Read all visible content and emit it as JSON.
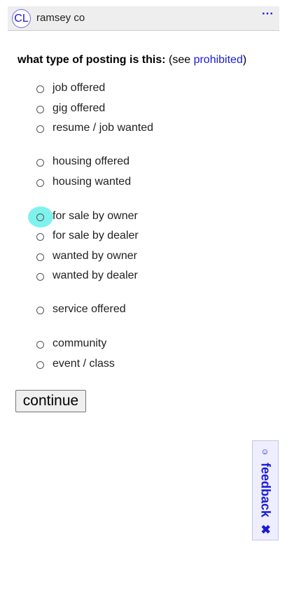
{
  "header": {
    "logo_text": "CL",
    "area_name": "ramsey co",
    "menu_icon": "ellipsis-icon",
    "menu_text": "···"
  },
  "question": {
    "bold_text": "what type of posting is this:",
    "see_text": " (see ",
    "link_text": "prohibited",
    "close_text": ")"
  },
  "options": [
    {
      "label": "job offered",
      "selected": false,
      "focused": false
    },
    {
      "label": "gig offered",
      "selected": false,
      "focused": false
    },
    {
      "label": "resume / job wanted",
      "selected": false,
      "focused": false
    },
    {
      "label": "housing offered",
      "selected": false,
      "focused": false
    },
    {
      "label": "housing wanted",
      "selected": false,
      "focused": false
    },
    {
      "label": "for sale by owner",
      "selected": false,
      "focused": true
    },
    {
      "label": "for sale by dealer",
      "selected": false,
      "focused": false
    },
    {
      "label": "wanted by owner",
      "selected": false,
      "focused": false
    },
    {
      "label": "wanted by dealer",
      "selected": false,
      "focused": false
    },
    {
      "label": "service offered",
      "selected": false,
      "focused": false
    },
    {
      "label": "community",
      "selected": false,
      "focused": false
    },
    {
      "label": "event / class",
      "selected": false,
      "focused": false
    }
  ],
  "continue_button": {
    "label": "continue"
  },
  "feedback": {
    "label": "feedback",
    "smile_icon": "smiley-icon",
    "smile_glyph": "☺",
    "close_icon": "close-icon",
    "close_glyph": "✖"
  },
  "colors": {
    "link": "#1a1ad6",
    "header_bg": "#eeeeee",
    "focus_ring": "#7ff2ee",
    "feedback_bg": "#eeeeff"
  }
}
